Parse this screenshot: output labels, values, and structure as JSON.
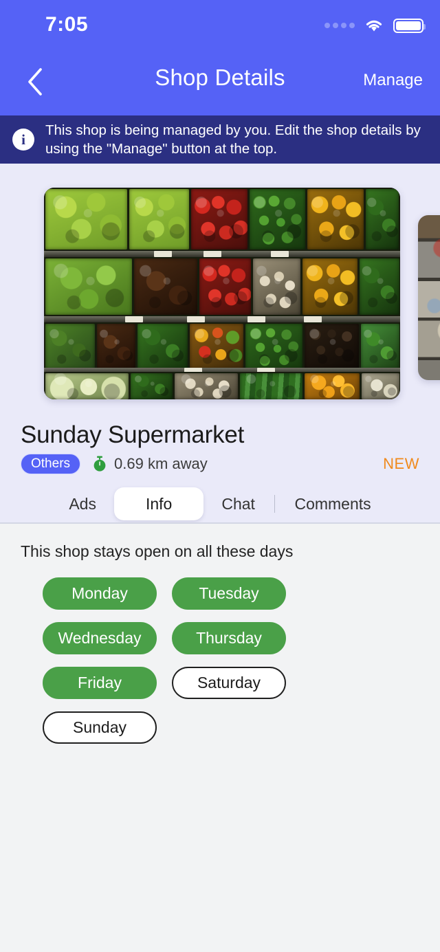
{
  "status_bar": {
    "time": "7:05",
    "signal_icon": "signal-dots-icon",
    "wifi_icon": "wifi-icon",
    "battery_icon": "battery-full-icon"
  },
  "nav_bar": {
    "back_icon": "chevron-left-icon",
    "title": "Shop Details",
    "action_label": "Manage"
  },
  "banner": {
    "icon": "info-icon",
    "icon_glyph": "i",
    "text": "This shop is being managed by you. Edit the shop details by using the \"Manage\" button at the top."
  },
  "shop": {
    "name": "Sunday Supermarket",
    "category_badge": "Others",
    "distance": "0.69 km away",
    "distance_icon": "timer-icon",
    "new_flag": "NEW"
  },
  "tabs": [
    {
      "label": "Ads",
      "active": false
    },
    {
      "label": "Info",
      "active": true
    },
    {
      "label": "Chat",
      "active": false
    },
    {
      "label": "Comments",
      "active": false
    }
  ],
  "info_panel": {
    "heading": "This shop stays open on all these days",
    "days": [
      {
        "label": "Monday",
        "open": true
      },
      {
        "label": "Tuesday",
        "open": true
      },
      {
        "label": "Wednesday",
        "open": true
      },
      {
        "label": "Thursday",
        "open": true
      },
      {
        "label": "Friday",
        "open": true
      },
      {
        "label": "Saturday",
        "open": false
      },
      {
        "label": "Sunday",
        "open": false
      }
    ]
  },
  "colors": {
    "header_blue": "#5562f6",
    "banner_navy": "#2b2f82",
    "upper_background": "#eaeaf9",
    "content_background": "#f2f3f4",
    "open_green": "#4aa048",
    "new_orange": "#f08a1d",
    "badge_blue": "#5562f6"
  }
}
